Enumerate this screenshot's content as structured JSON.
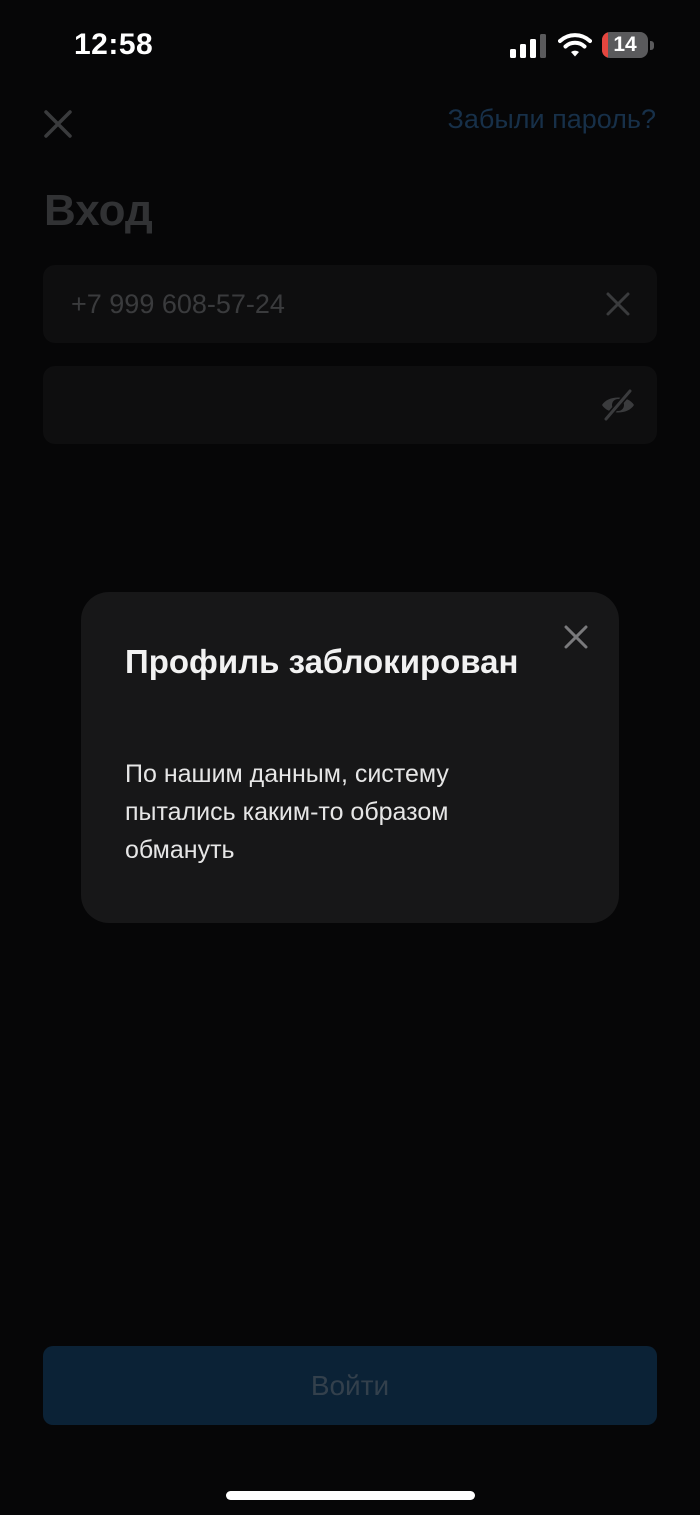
{
  "status_bar": {
    "time": "12:58",
    "battery_level": "14",
    "battery_fraction": 0.14,
    "icons": [
      "signal-icon",
      "wifi-icon",
      "battery-icon"
    ]
  },
  "header": {
    "close_icon": "close-icon",
    "forgot_password": "Забыли пароль?"
  },
  "page": {
    "title": "Вход"
  },
  "form": {
    "phone_value": "+7 999 608-57-24",
    "password_value": ""
  },
  "login_button": {
    "label": "Войти"
  },
  "modal": {
    "title": "Профиль заблокирован",
    "message": "По нашим данным, систему пытались каким-то образом обмануть"
  },
  "colors": {
    "background": "#060607",
    "modal_background": "#171718",
    "button_background": "#0b2236",
    "link": "#173049",
    "battery_low": "#e4463f"
  }
}
